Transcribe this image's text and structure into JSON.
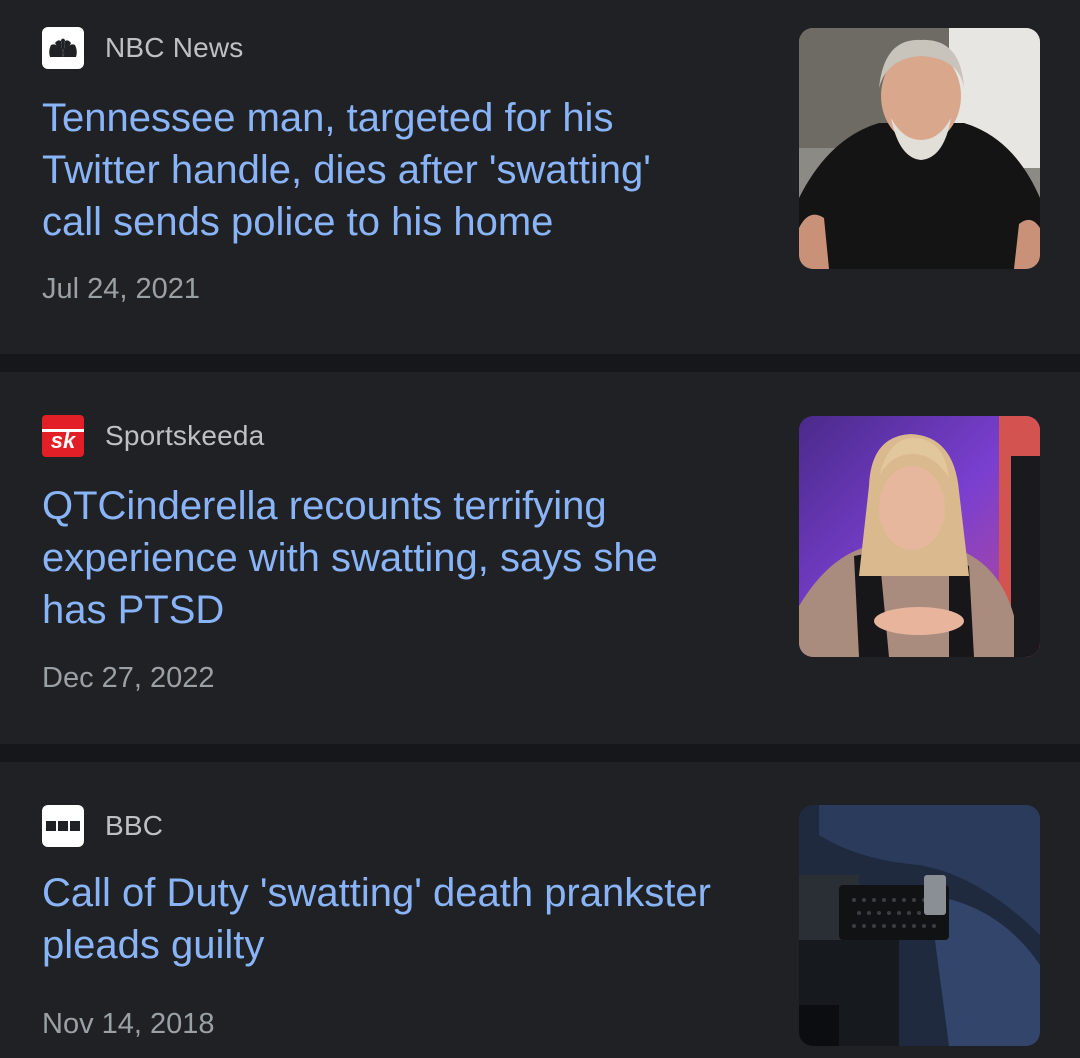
{
  "articles": [
    {
      "source": "NBC News",
      "source_icon": "nbc-peacock-icon",
      "headline": "Tennessee man, targeted for his Twitter handle, dies after 'swatting' call sends police to his home",
      "date": "Jul 24, 2021",
      "thumbnail": "man-in-black-shirt-photo"
    },
    {
      "source": "Sportskeeda",
      "source_icon": "sportskeeda-logo-icon",
      "source_icon_text": "sk",
      "headline": "QTCinderella recounts terrifying experience with swatting, says she has PTSD",
      "date": "Dec 27, 2022",
      "thumbnail": "woman-streamer-photo"
    },
    {
      "source": "BBC",
      "source_icon": "bbc-blocks-icon",
      "headline": "Call of Duty 'swatting' death prankster pleads guilty",
      "date": "Nov 14, 2018",
      "thumbnail": "police-belt-photo"
    }
  ],
  "colors": {
    "background": "#16171a",
    "card": "#202124",
    "headline": "#8ab4f8",
    "source": "#bdc1c6",
    "date": "#9aa0a6",
    "sportskeeda_red": "#e21f26"
  }
}
